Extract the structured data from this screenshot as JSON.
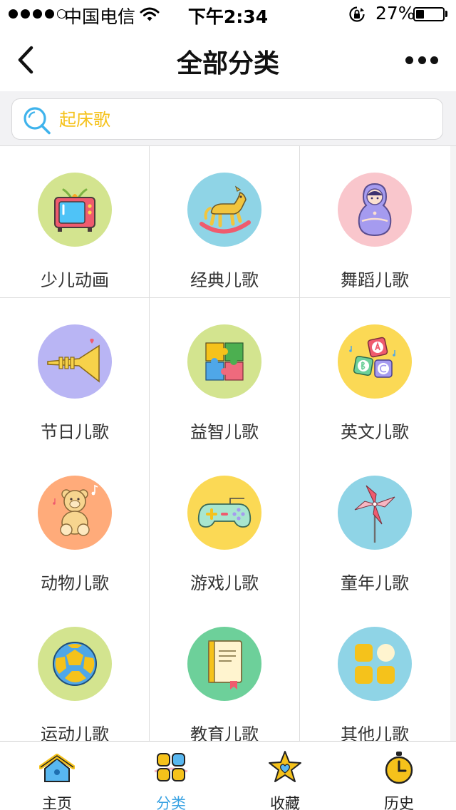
{
  "status_bar": {
    "carrier": "中国电信",
    "time": "下午2:34",
    "battery_percent": "27%",
    "battery_level": 0.27,
    "signal_bars_filled": 4,
    "signal_bars_total": 5
  },
  "nav": {
    "title": "全部分类",
    "back_icon": "chevron-left-icon",
    "more_icon": "more-dots-icon"
  },
  "search": {
    "placeholder": "起床歌",
    "icon": "search-icon",
    "accent_color": "#f5c21b"
  },
  "categories": [
    {
      "label": "少儿动画",
      "icon": "tv-icon",
      "color": "#d3e48f"
    },
    {
      "label": "经典儿歌",
      "icon": "rocking-horse-icon",
      "color": "#8fd4e6"
    },
    {
      "label": "舞蹈儿歌",
      "icon": "matryoshka-doll-icon",
      "color": "#f9c6cc"
    },
    {
      "label": "节日儿歌",
      "icon": "trumpet-icon",
      "color": "#b9b5f4"
    },
    {
      "label": "益智儿歌",
      "icon": "puzzle-icon",
      "color": "#d3e48f"
    },
    {
      "label": "英文儿歌",
      "icon": "abc-blocks-icon",
      "color": "#fbd955"
    },
    {
      "label": "动物儿歌",
      "icon": "teddy-bear-icon",
      "color": "#ffab7a"
    },
    {
      "label": "游戏儿歌",
      "icon": "gamepad-icon",
      "color": "#fbd955"
    },
    {
      "label": "童年儿歌",
      "icon": "pinwheel-icon",
      "color": "#8fd4e6"
    },
    {
      "label": "运动儿歌",
      "icon": "ball-icon",
      "color": "#d3e48f"
    },
    {
      "label": "教育儿歌",
      "icon": "book-icon",
      "color": "#6dd09a"
    },
    {
      "label": "其他儿歌",
      "icon": "more-apps-icon",
      "color": "#8fd4e6"
    }
  ],
  "tabbar": {
    "active_color": "#3aa3e3",
    "tabs": [
      {
        "label": "主页",
        "icon": "home-icon",
        "active": false
      },
      {
        "label": "分类",
        "icon": "category-grid-icon",
        "active": true
      },
      {
        "label": "收藏",
        "icon": "star-heart-icon",
        "active": false
      },
      {
        "label": "历史",
        "icon": "stopwatch-icon",
        "active": false
      }
    ]
  }
}
